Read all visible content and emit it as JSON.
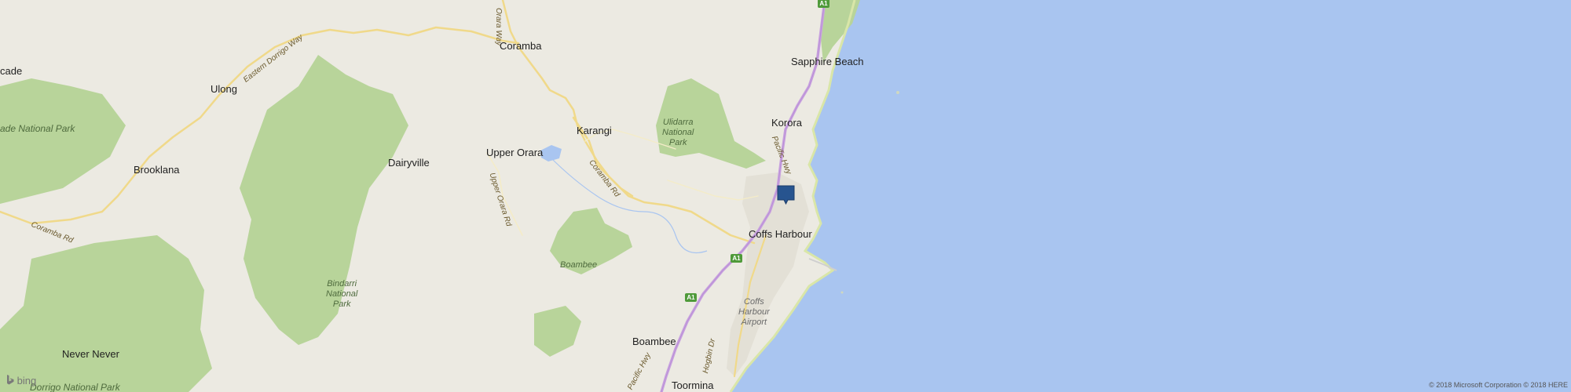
{
  "map": {
    "towns": [
      {
        "id": "coramba",
        "name": "Coramba"
      },
      {
        "id": "sapphire-beach",
        "name": "Sapphire Beach"
      },
      {
        "id": "ulong",
        "name": "Ulong"
      },
      {
        "id": "korora",
        "name": "Korora"
      },
      {
        "id": "karangi",
        "name": "Karangi"
      },
      {
        "id": "upper-orara",
        "name": "Upper Orara"
      },
      {
        "id": "dairyville",
        "name": "Dairyville"
      },
      {
        "id": "brooklana",
        "name": "Brooklana"
      },
      {
        "id": "coffs-harbour",
        "name": "Coffs Harbour"
      },
      {
        "id": "boambee",
        "name": "Boambee"
      },
      {
        "id": "never-never",
        "name": "Never Never"
      },
      {
        "id": "toormina",
        "name": "Toormina"
      },
      {
        "id": "cascade-partial",
        "name": "cade"
      }
    ],
    "parks": [
      {
        "id": "ulidarra",
        "lines": [
          "Ulidarra",
          "National",
          "Park"
        ]
      },
      {
        "id": "bindarri",
        "lines": [
          "Bindarri",
          "National",
          "Park"
        ]
      },
      {
        "id": "boambee-forest",
        "lines": [
          "Boambee"
        ]
      },
      {
        "id": "cascade-np",
        "lines": [
          "ade National Park"
        ]
      },
      {
        "id": "dorrigo-np",
        "lines": [
          "Dorrigo National Park"
        ]
      }
    ],
    "roads": [
      {
        "id": "eastern-dorrigo-way",
        "name": "Eastern Dorrigo Way"
      },
      {
        "id": "orara-way",
        "name": "Orara Way"
      },
      {
        "id": "coramba-rd-east",
        "name": "Coramba Rd"
      },
      {
        "id": "coramba-rd-west",
        "name": "Coramba Rd"
      },
      {
        "id": "upper-orara-rd",
        "name": "Upper Orara Rd"
      },
      {
        "id": "pacific-hwy-north",
        "name": "Pacific Hwy"
      },
      {
        "id": "pacific-hwy-south",
        "name": "Pacific Hwy"
      },
      {
        "id": "hogbin-dr",
        "name": "Hogbin Dr"
      }
    ],
    "airport": {
      "lines": [
        "Coffs",
        "Harbour",
        "Airport"
      ]
    },
    "shields": [
      {
        "id": "a1-top",
        "label": "A1"
      },
      {
        "id": "a1-mid",
        "label": "A1"
      },
      {
        "id": "a1-low",
        "label": "A1"
      }
    ],
    "colors": {
      "land": "#eceae2",
      "water": "#a9c5f0",
      "park": "#b8d49a",
      "road": "#f0d98a",
      "highway": "#c9a3df",
      "marker": "#27548f"
    }
  },
  "branding": {
    "logo": "bing"
  },
  "copyright": "© 2018 Microsoft Corporation © 2018 HERE"
}
